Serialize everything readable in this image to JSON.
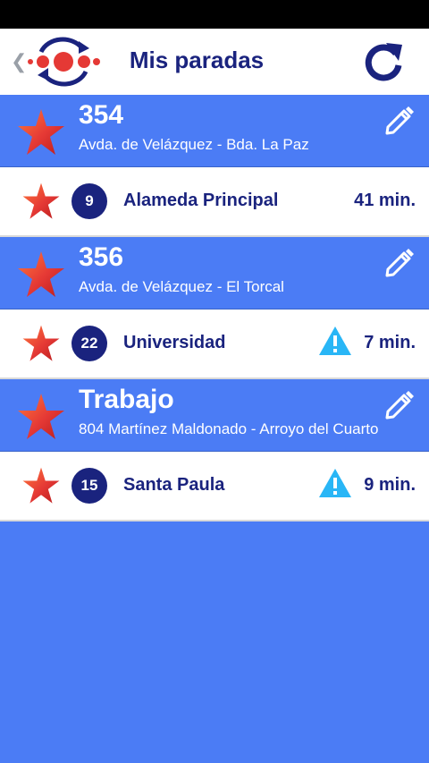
{
  "header": {
    "title": "Mis paradas",
    "back_icon": "chevron-left-icon",
    "logo": "bus-logo",
    "refresh_icon": "refresh-icon"
  },
  "colors": {
    "accent": "#4b7cf5",
    "navy": "#1a237e",
    "warning": "#29b6f6",
    "star_red": "#d32f2f",
    "star_orange": "#ff7043"
  },
  "stops": [
    {
      "name": "354",
      "address": "Avda. de Velázquez - Bda. La Paz",
      "lines": [
        {
          "number": "9",
          "destination": "Alameda Principal",
          "eta": "41 min.",
          "warning": false
        }
      ]
    },
    {
      "name": "356",
      "address": "Avda. de Velázquez - El Torcal",
      "lines": [
        {
          "number": "22",
          "destination": "Universidad",
          "eta": "7 min.",
          "warning": true
        }
      ]
    },
    {
      "name": "Trabajo",
      "address": "804 Martínez Maldonado - Arroyo del Cuarto",
      "lines": [
        {
          "number": "15",
          "destination": "Santa Paula",
          "eta": "9 min.",
          "warning": true
        }
      ]
    }
  ]
}
